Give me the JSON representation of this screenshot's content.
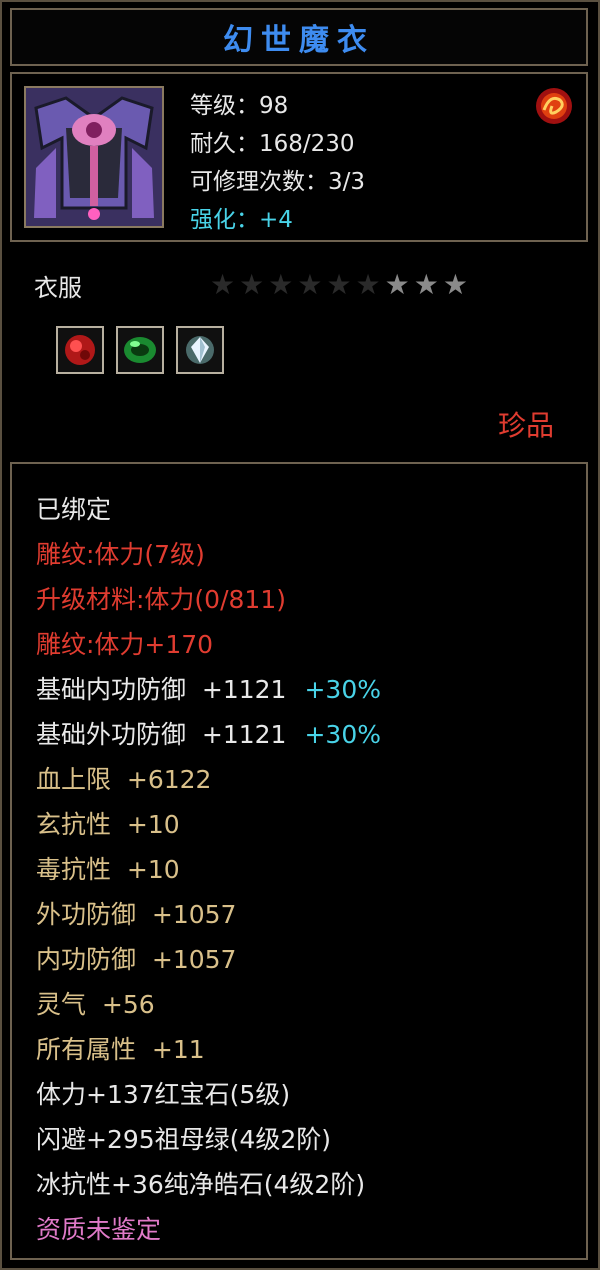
{
  "title": "幻世魔衣",
  "stats": {
    "level": "等级：98",
    "durability": "耐久：168/230",
    "repairs": "可修理次数：3/3",
    "enhance": "强化：+4"
  },
  "type": "衣服",
  "stars": {
    "filled": 3,
    "total": 9
  },
  "gems": [
    "ruby-gem-icon",
    "emerald-gem-icon",
    "diamond-gem-icon"
  ],
  "rarity": "珍品",
  "attributes": [
    {
      "text": "已绑定",
      "color": "white"
    },
    {
      "text": "雕纹:体力(7级)",
      "color": "red"
    },
    {
      "text": "升级材料:体力(0/811)",
      "color": "red"
    },
    {
      "text": "雕纹:体力+170",
      "color": "red"
    },
    {
      "text": "基础内功防御  +1121",
      "color": "white",
      "bonus": "+30%"
    },
    {
      "text": "基础外功防御  +1121",
      "color": "white",
      "bonus": "+30%"
    },
    {
      "text": "血上限  +6122",
      "color": "gold"
    },
    {
      "text": "玄抗性  +10",
      "color": "gold"
    },
    {
      "text": "毒抗性  +10",
      "color": "gold"
    },
    {
      "text": "外功防御  +1057",
      "color": "gold"
    },
    {
      "text": "内功防御  +1057",
      "color": "gold"
    },
    {
      "text": "灵气  +56",
      "color": "gold"
    },
    {
      "text": "所有属性  +11",
      "color": "gold"
    },
    {
      "text": "体力+137红宝石(5级)",
      "color": "white"
    },
    {
      "text": "闪避+295祖母绿(4级2阶)",
      "color": "white"
    },
    {
      "text": "冰抗性+36纯净皓石(4级2阶)",
      "color": "white"
    },
    {
      "text": "资质未鉴定",
      "color": "pink"
    }
  ]
}
